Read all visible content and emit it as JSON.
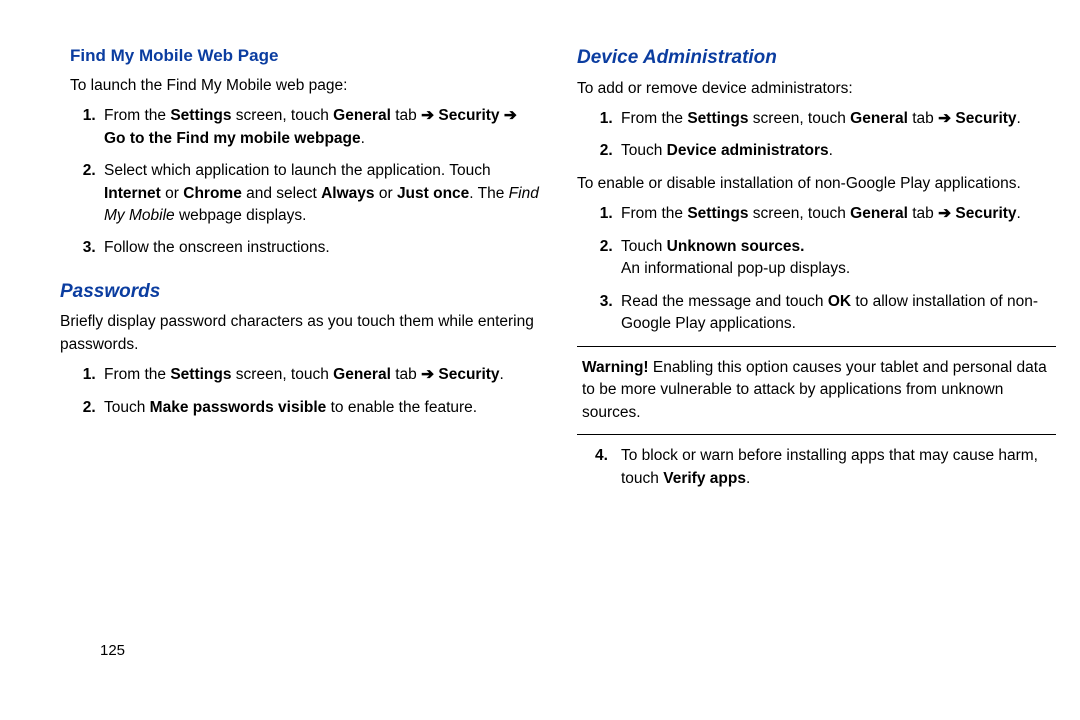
{
  "page_number": "125",
  "arrow": "➔",
  "left": {
    "h_find": "Find My Mobile Web Page",
    "find_intro": "To launch the Find My Mobile web page:",
    "find_step1_a": "From the ",
    "find_step1_b": "Settings",
    "find_step1_c": " screen, touch ",
    "find_step1_d": "General",
    "find_step1_e": " tab ",
    "find_step1_f": "Security",
    "find_step1_g": "Go to the Find my mobile webpage",
    "find_step2_a": "Select which application to launch the application. Touch ",
    "find_step2_b": "Internet",
    "find_step2_c": " or ",
    "find_step2_d": "Chrome",
    "find_step2_e": " and select ",
    "find_step2_f": "Always",
    "find_step2_g": " or ",
    "find_step2_h": "Just once",
    "find_step2_i": ". The ",
    "find_step2_j": "Find My Mobile",
    "find_step2_k": " webpage displays.",
    "find_step3": "Follow the onscreen instructions.",
    "h_pw": "Passwords",
    "pw_intro": "Briefly display password characters as you touch them while entering passwords.",
    "pw_step1_a": "From the ",
    "pw_step1_b": "Settings",
    "pw_step1_c": " screen, touch ",
    "pw_step1_d": "General",
    "pw_step1_e": " tab ",
    "pw_step1_f": "Security",
    "pw_step2_a": "Touch ",
    "pw_step2_b": "Make passwords visible",
    "pw_step2_c": " to enable the feature."
  },
  "right": {
    "h_dev": "Device Administration",
    "dev_intro1": "To add or remove device administrators:",
    "dev1_step1_a": "From the ",
    "dev1_step1_b": "Settings",
    "dev1_step1_c": " screen, touch ",
    "dev1_step1_d": "General",
    "dev1_step1_e": " tab ",
    "dev1_step1_f": "Security",
    "dev1_step2_a": "Touch ",
    "dev1_step2_b": "Device administrators",
    "dev_intro2": "To enable or disable installation of non-Google Play applications.",
    "dev2_step1_a": "From the ",
    "dev2_step1_b": "Settings",
    "dev2_step1_c": " screen, touch ",
    "dev2_step1_d": "General",
    "dev2_step1_e": " tab ",
    "dev2_step1_f": "Security",
    "dev2_step2_a": "Touch ",
    "dev2_step2_b": "Unknown sources.",
    "dev2_step2_c": "An informational pop-up displays.",
    "dev2_step3_a": "Read the message and touch ",
    "dev2_step3_b": "OK",
    "dev2_step3_c": " to allow installation of non-Google Play applications.",
    "warn_label": "Warning!",
    "warn_text": " Enabling this option causes your tablet and personal data to be more vulnerable to attack by applications from unknown sources.",
    "dev2_step4_a": "To block or warn before installing apps that may cause harm, touch ",
    "dev2_step4_b": "Verify apps"
  }
}
